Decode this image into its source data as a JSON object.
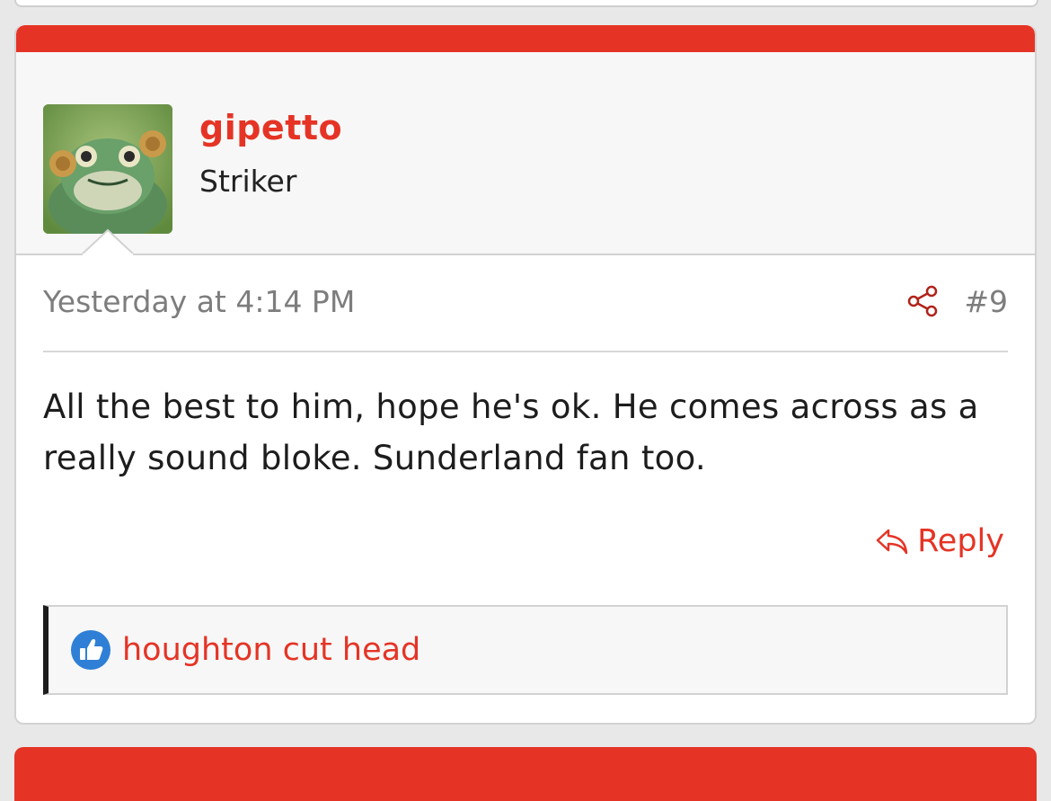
{
  "post": {
    "username": "gipetto",
    "user_title": "Striker",
    "avatar_alt": "frog-avatar",
    "date": "Yesterday at 4:14 PM",
    "number": "#9",
    "body_line1": "All the best to him, hope he's ok. He comes across as a",
    "body_line2": "really sound bloke. Sunderland fan too.",
    "reply_label": "Reply",
    "likes": [
      "houghton cut head"
    ]
  },
  "colors": {
    "accent": "#e53425",
    "muted_text": "#7d7d7d",
    "like_blue": "#2f7fd6"
  },
  "icons": {
    "share": "share-icon",
    "reply": "reply-icon",
    "like": "thumbs-up-icon"
  }
}
